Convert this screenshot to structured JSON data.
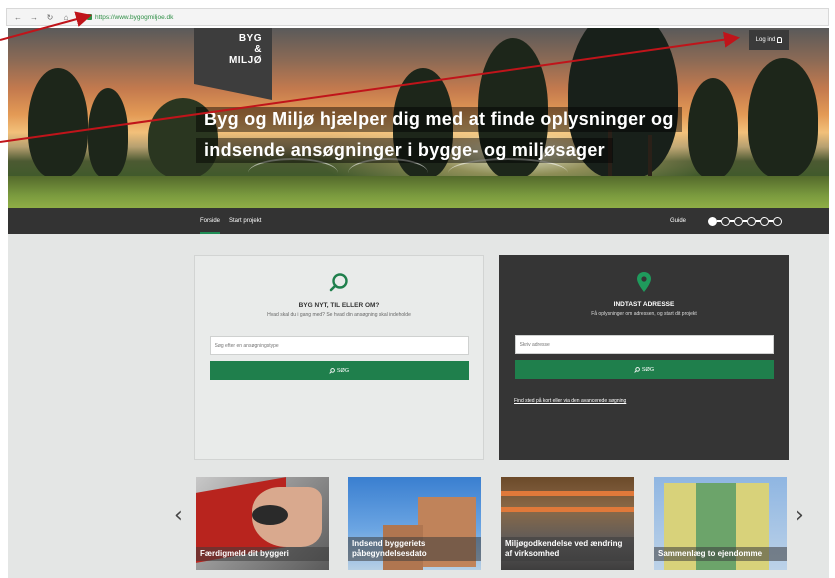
{
  "browser": {
    "url": "https://www.bygogmiljoe.dk",
    "nav_icons": [
      "back-icon",
      "forward-icon",
      "reload-icon",
      "home-icon"
    ]
  },
  "header": {
    "logo_lines": [
      "BYG",
      "&",
      "MILJØ"
    ],
    "login_label": "Log ind",
    "headline_line1": "Byg og Miljø hjælper dig med at finde oplysninger og",
    "headline_line2": "indsende ansøgninger i bygge- og miljøsager"
  },
  "navbar": {
    "items": [
      {
        "label": "Forside",
        "active": true
      },
      {
        "label": "Start projekt",
        "active": false
      }
    ],
    "guide_label": "Guide",
    "steps_total": 6,
    "step_current": 1
  },
  "search_panel": {
    "icon": "search-icon",
    "title": "BYG NYT, TIL ELLER OM?",
    "subtitle": "Hvad skal du i gang med? Se hvad din ansøgning skal indeholde",
    "input_placeholder": "Søg efter en ansøgningstype",
    "button_label": "SØG"
  },
  "address_panel": {
    "icon": "location-pin-icon",
    "title": "INDTAST ADRESSE",
    "subtitle": "Få oplysninger om adressen, og start dit projekt",
    "input_placeholder": "Skriv adresse",
    "button_label": "SØG",
    "advanced_link": "Find sted på kort eller via den avancerede søgning"
  },
  "carousel": {
    "cards": [
      {
        "label": "Færdigmeld dit byggeri"
      },
      {
        "label": "Indsend byggeriets påbegyndelsesdato"
      },
      {
        "label": "Miljøgodkendelse ved ændring af virksomhed"
      },
      {
        "label": "Sammenlæg to ejendomme"
      }
    ]
  },
  "colors": {
    "primary_green": "#1f7f4c",
    "dark": "#333333",
    "annotation_red": "#c0141a"
  }
}
